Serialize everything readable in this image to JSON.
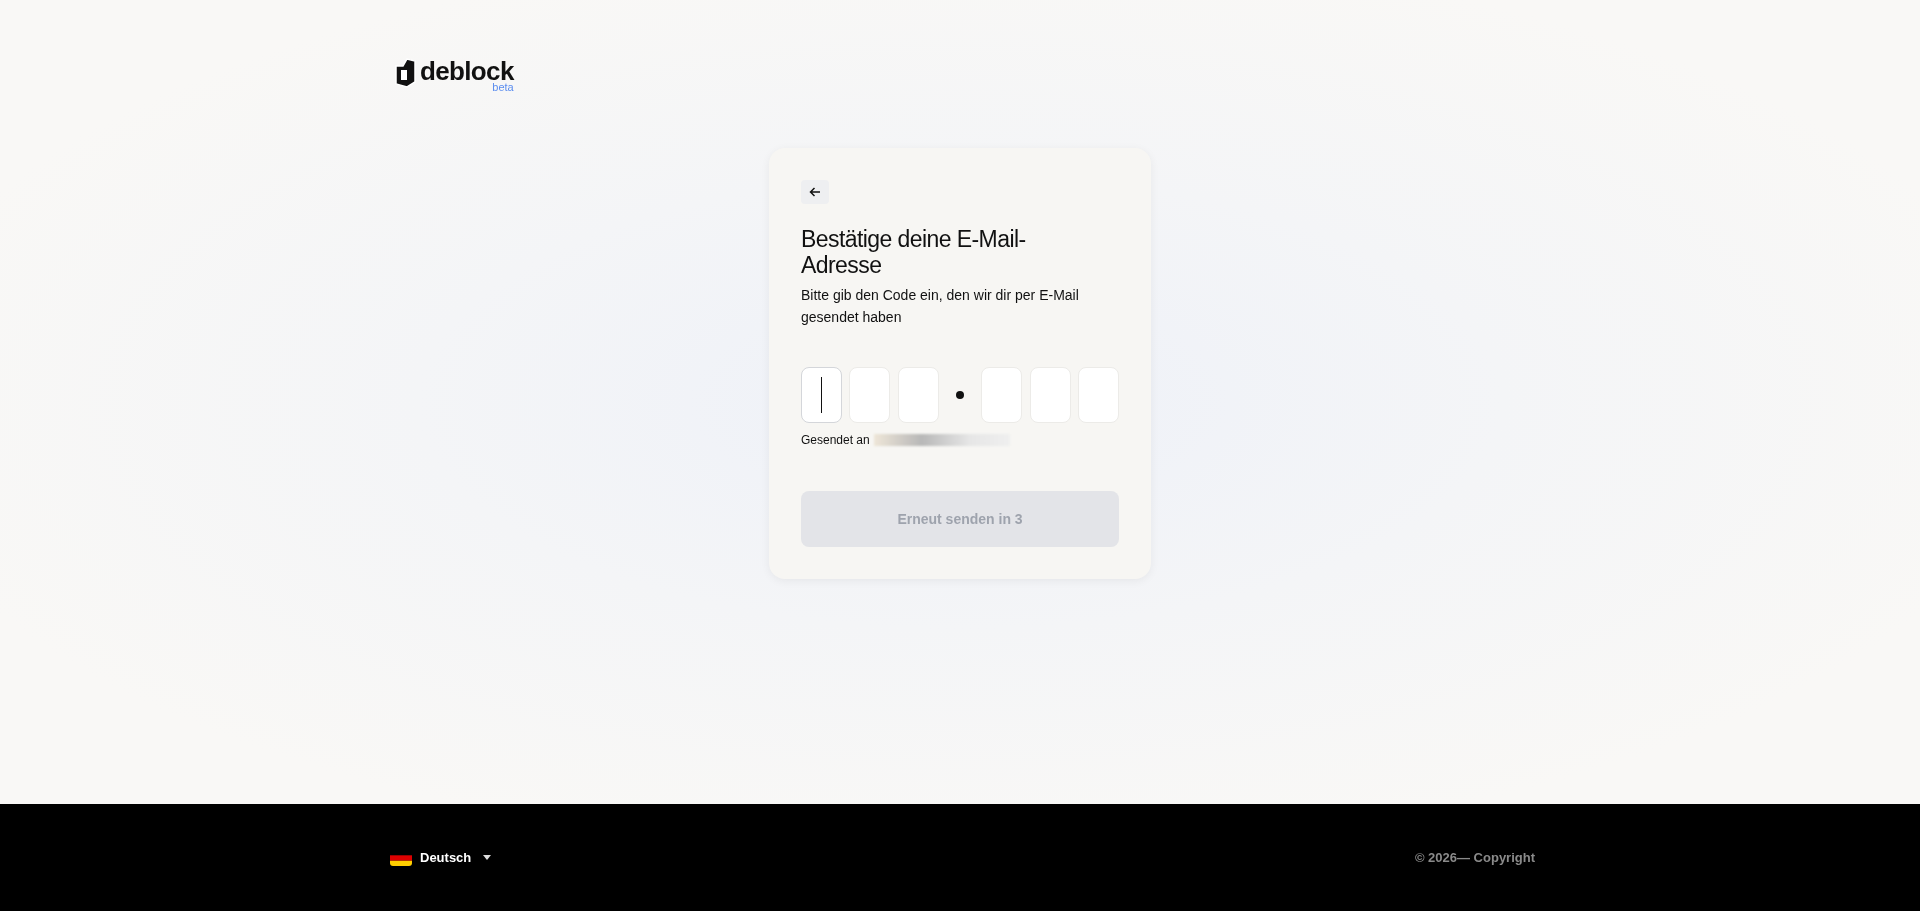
{
  "logo": {
    "name": "deblock",
    "badge": "beta"
  },
  "card": {
    "title": "Bestätige deine E-Mail-Adresse",
    "subtitle": "Bitte gib den Code ein, den wir dir per E-Mail gesendet haben",
    "code_fields": [
      {
        "focused": true
      },
      {
        "focused": false
      },
      {
        "focused": false
      },
      {
        "kind": "separator"
      },
      {
        "focused": false
      },
      {
        "focused": false
      },
      {
        "focused": false
      }
    ],
    "sent_to_label": "Gesendet an",
    "resend_button": {
      "label": "Erneut senden in 3",
      "disabled": true
    }
  },
  "footer": {
    "language": "Deutsch",
    "copyright": "© 2026— Copyright"
  }
}
